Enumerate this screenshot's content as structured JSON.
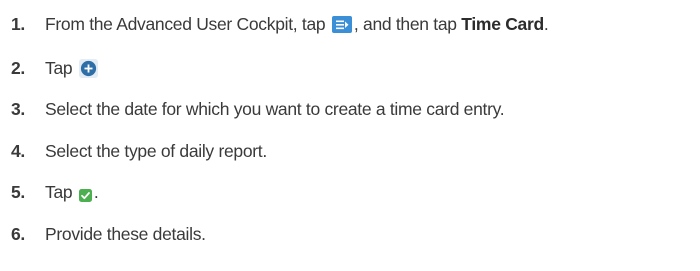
{
  "steps": [
    {
      "number": "1.",
      "text_before": "From the Advanced User Cockpit, tap",
      "icon": "menu-arrow-icon",
      "text_middle": ", and then tap",
      "bold_text": "Time Card",
      "text_after": "."
    },
    {
      "number": "2.",
      "text_before": "Tap",
      "icon": "plus-circle-icon"
    },
    {
      "number": "3.",
      "text": "Select the date for which you want to create a time card entry."
    },
    {
      "number": "4.",
      "text": "Select the type of daily report."
    },
    {
      "number": "5.",
      "text_before": "Tap",
      "icon": "checkmark-icon",
      "text_after": "."
    },
    {
      "number": "6.",
      "text": "Provide these details."
    }
  ],
  "colors": {
    "menu_icon_bg": "#3b8fd6",
    "plus_icon_bg": "#2f6fa8",
    "check_icon_bg": "#4caf50",
    "text": "#3a3a3a"
  }
}
